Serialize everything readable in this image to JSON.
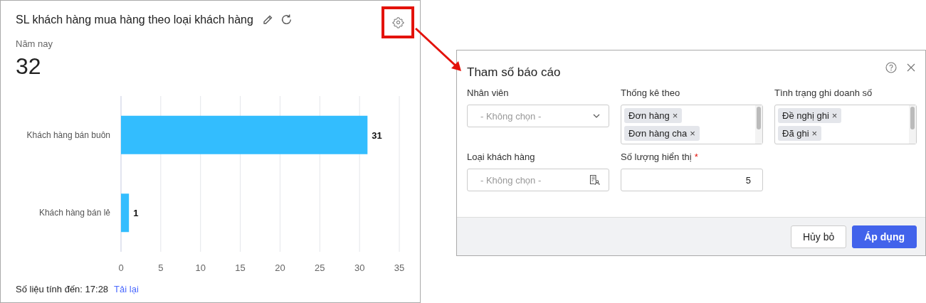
{
  "card": {
    "title": "SL khách hàng mua hàng theo loại khách hàng",
    "period_label": "Năm nay",
    "total": "32",
    "chart_data": {
      "type": "bar",
      "orientation": "horizontal",
      "categories": [
        "Khách hàng bán buôn",
        "Khách hàng bán lẻ"
      ],
      "series": [
        {
          "color": "#33bdfe",
          "values": [
            31,
            1
          ]
        }
      ],
      "xlim": [
        0,
        35
      ],
      "xticks": [
        0,
        5,
        10,
        15,
        20,
        25,
        30,
        35
      ],
      "grid": true,
      "data_labels": true
    },
    "footer": {
      "as_of": "Số liệu tính đến: 17:28",
      "reload_link": "Tải lại"
    }
  },
  "dialog": {
    "title": "Tham số báo cáo",
    "fields": [
      {
        "kind": "select",
        "label": "Nhân viên",
        "placeholder": "- Không chọn -"
      },
      {
        "kind": "tags",
        "label": "Thống kê theo",
        "tags": [
          {
            "label": "Đơn hàng",
            "remove": "×"
          },
          {
            "label": "Đơn hàng cha",
            "remove": "×"
          }
        ]
      },
      {
        "kind": "tags",
        "label": "Tình trạng ghi doanh số",
        "tags": [
          {
            "label": "Đề nghị ghi",
            "remove": "×"
          },
          {
            "label": "Đã ghi",
            "remove": "×"
          }
        ]
      },
      {
        "kind": "lookup",
        "label": "Loại khách hàng",
        "placeholder": "- Không chọn -"
      },
      {
        "kind": "number",
        "label": "Số lượng hiển thị",
        "required_mark": "*",
        "value": "5"
      }
    ],
    "buttons": [
      {
        "label": "Hủy bỏ",
        "kind": "secondary"
      },
      {
        "label": "Áp dụng",
        "kind": "primary"
      }
    ]
  }
}
